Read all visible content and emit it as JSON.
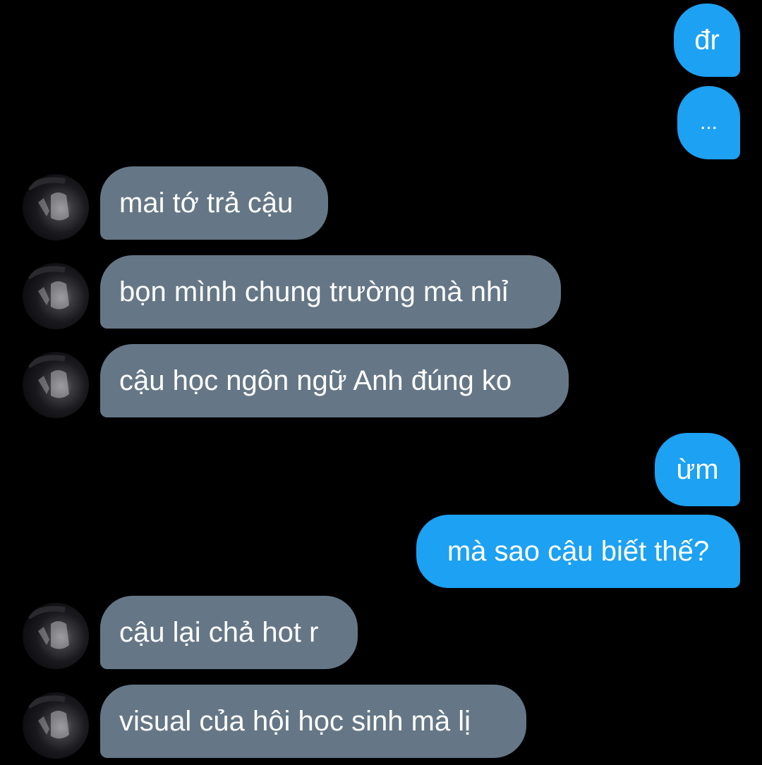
{
  "theme": {
    "background": "#000000",
    "sent_bubble_color": "#1da1f2",
    "received_bubble_color": "#657786",
    "text_color": "#ffffff"
  },
  "messages": [
    {
      "direction": "sent",
      "text": "đr"
    },
    {
      "direction": "sent",
      "text": "..."
    },
    {
      "direction": "received",
      "text": "mai tớ trả cậu",
      "avatar_icon": "user-avatar"
    },
    {
      "direction": "received",
      "text": "bọn mình chung trường mà nhỉ",
      "avatar_icon": "user-avatar"
    },
    {
      "direction": "received",
      "text": "cậu học ngôn ngữ Anh đúng ko",
      "avatar_icon": "user-avatar"
    },
    {
      "direction": "sent",
      "text": "ừm"
    },
    {
      "direction": "sent",
      "text": "mà sao cậu biết thế?"
    },
    {
      "direction": "received",
      "text": "cậu lại chả hot r",
      "avatar_icon": "user-avatar"
    },
    {
      "direction": "received",
      "text": "visual của hội học sinh mà lị",
      "avatar_icon": "user-avatar"
    }
  ]
}
